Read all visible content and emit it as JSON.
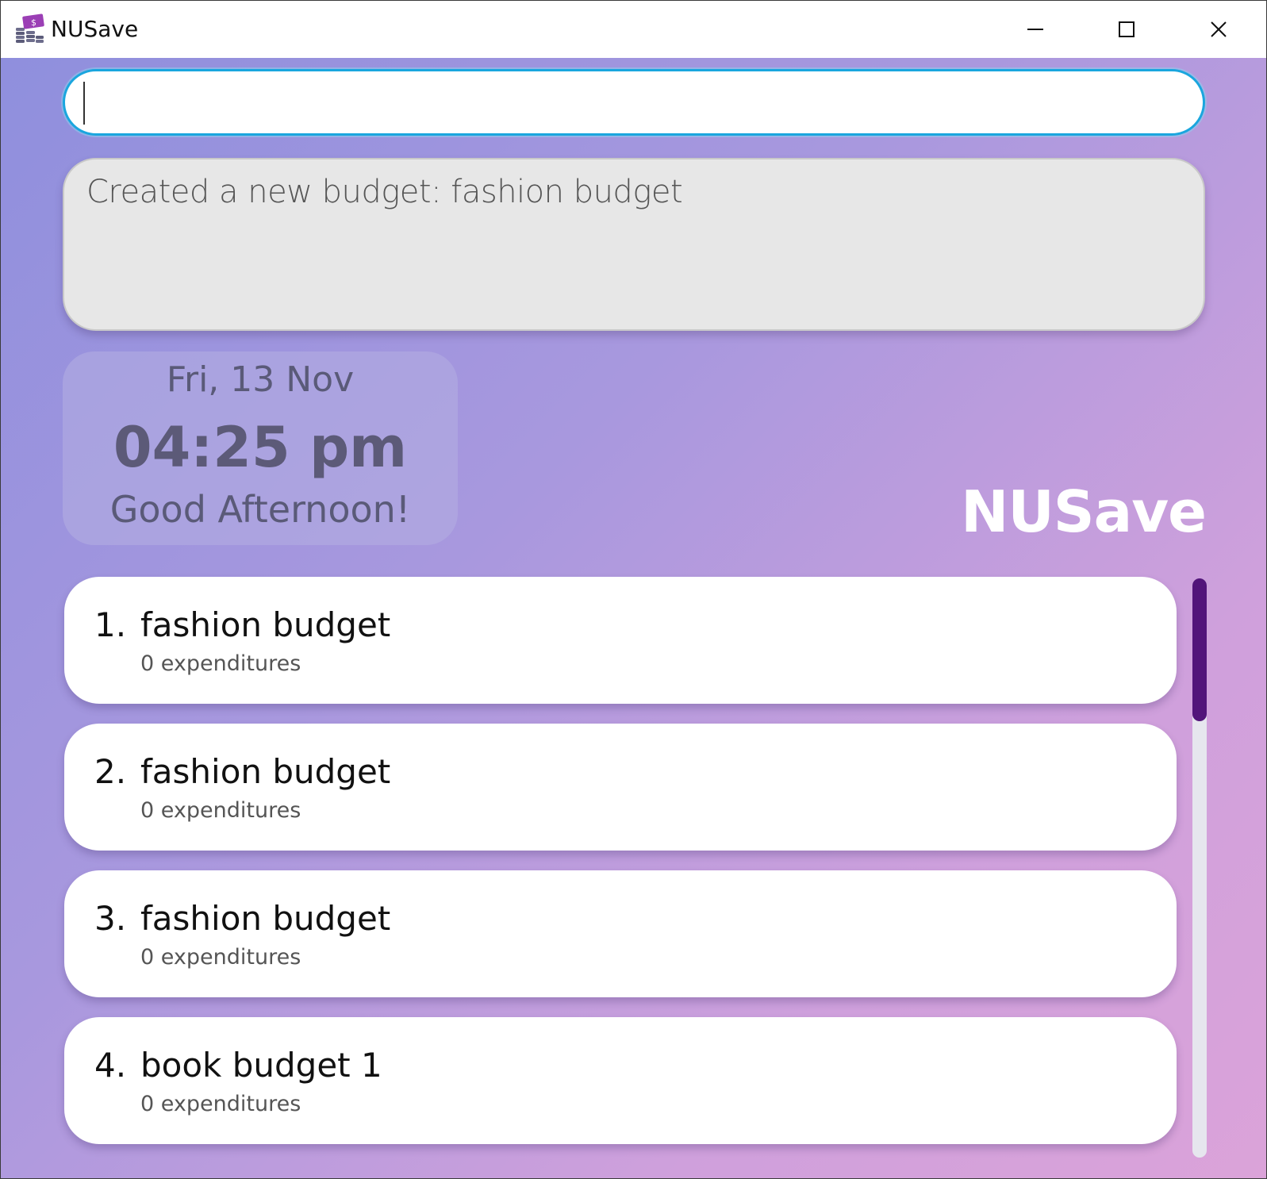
{
  "window": {
    "title": "NUSave",
    "icon": "money-stack-icon",
    "controls": [
      "minimize-icon",
      "maximize-icon",
      "close-icon"
    ]
  },
  "command": {
    "value": "",
    "placeholder": ""
  },
  "result": {
    "message": "Created a new budget: fashion budget"
  },
  "clock": {
    "date": "Fri, 13 Nov",
    "time": "04:25 pm",
    "greeting": "Good Afternoon!"
  },
  "brand": {
    "name": "NUSave"
  },
  "budgets": [
    {
      "index": "1.",
      "name": "fashion budget",
      "count": "0 expenditures"
    },
    {
      "index": "2.",
      "name": "fashion budget",
      "count": "0 expenditures"
    },
    {
      "index": "3.",
      "name": "fashion budget",
      "count": "0 expenditures"
    },
    {
      "index": "4.",
      "name": "book budget 1",
      "count": "0 expenditures"
    }
  ],
  "colors": {
    "accent": "#1aa6de",
    "scroll_thumb": "#52147a",
    "gradient_start": "#8f8fdd",
    "gradient_end": "#dba3d9"
  }
}
